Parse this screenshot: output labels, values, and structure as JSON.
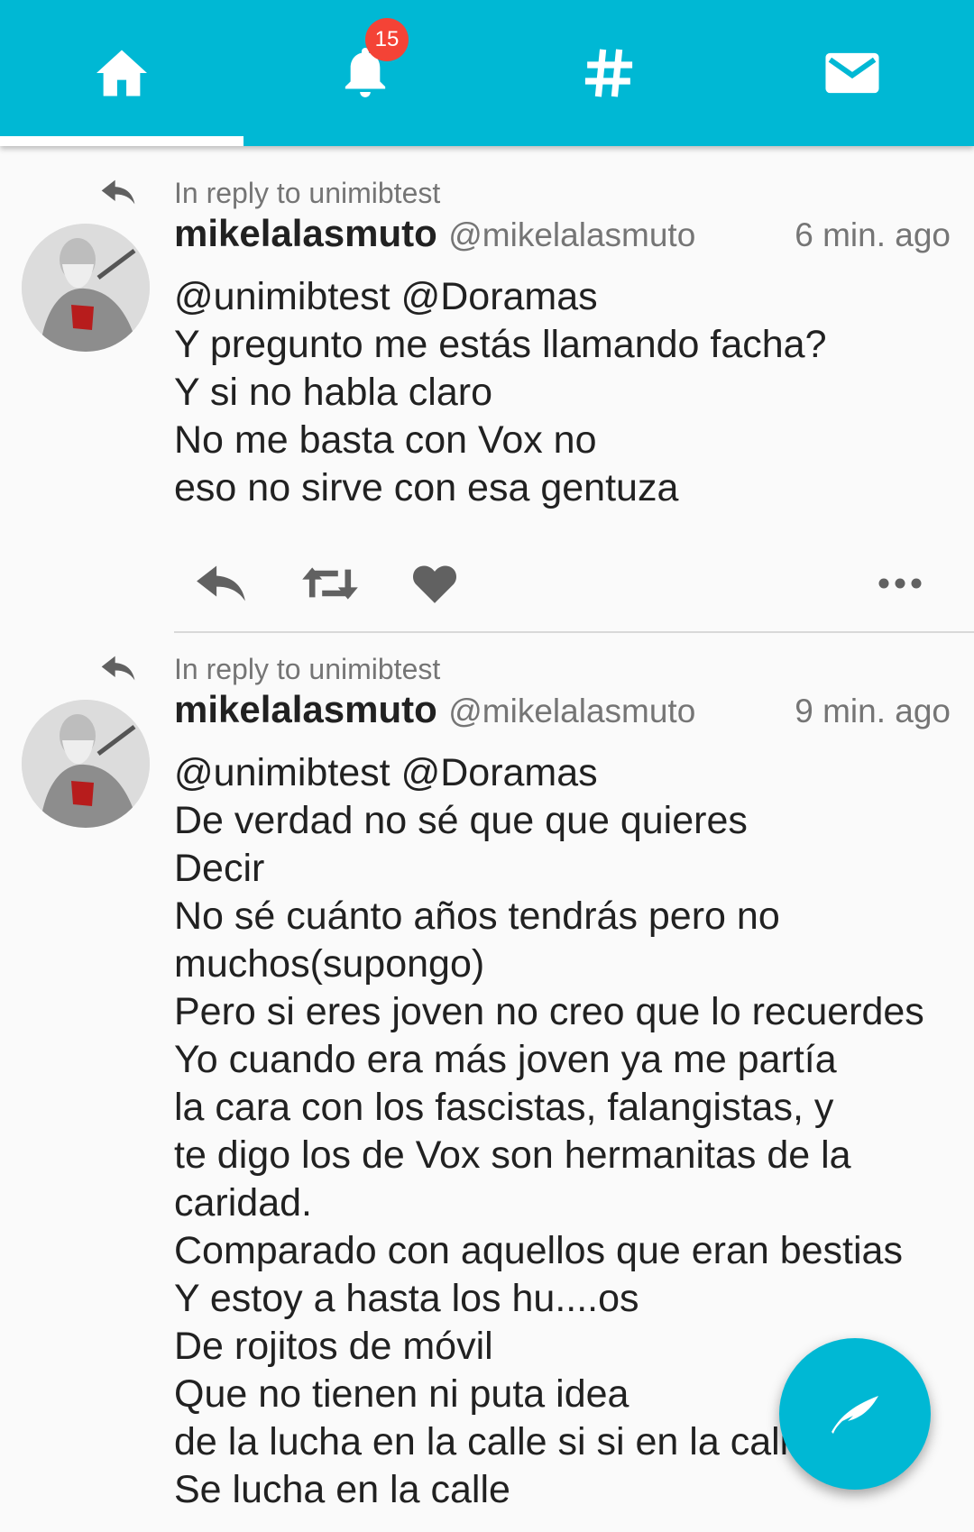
{
  "tabs": [
    {
      "name": "home",
      "icon": "home-icon",
      "active": true
    },
    {
      "name": "notifications",
      "icon": "bell-icon",
      "badge": "15"
    },
    {
      "name": "explore",
      "icon": "hashtag-icon"
    },
    {
      "name": "messages",
      "icon": "mail-icon"
    }
  ],
  "colors": {
    "accent": "#00b8d4",
    "badge": "#f44336",
    "secondary_text": "#757575"
  },
  "posts": [
    {
      "reply_to": "In reply to unimibtest",
      "display_name": "mikelalasmuto",
      "handle": "@mikelalasmuto",
      "time": "6 min. ago",
      "lines": [
        "@unimibtest @Doramas",
        "Y pregunto me estás llamando facha?",
        "Y si no habla claro",
        "No me basta con Vox no",
        "eso no sirve con esa gentuza"
      ],
      "actions": [
        "reply-icon",
        "retweet-icon",
        "like-icon",
        "more-icon"
      ]
    },
    {
      "reply_to": "In reply to unimibtest",
      "display_name": "mikelalasmuto",
      "handle": "@mikelalasmuto",
      "time": "9 min. ago",
      "lines": [
        "@unimibtest @Doramas",
        "De verdad no sé que que quieres",
        "Decir",
        "No sé cuánto años tendrás pero no",
        "muchos(supongo)",
        "Pero si eres joven no creo que lo recuerdes",
        "Yo cuando era más joven ya me partía",
        "la cara con los fascistas, falangistas, y",
        "te digo los de Vox son hermanitas de la",
        "caridad.",
        "Comparado con aquellos que eran bestias",
        "Y estoy a hasta los hu....os",
        "De rojitos de móvil",
        "Que no tienen ni puta idea",
        "de la lucha en la calle si si en la calle",
        "Se lucha en la calle"
      ]
    }
  ],
  "fab": {
    "icon": "compose-quill-icon"
  }
}
